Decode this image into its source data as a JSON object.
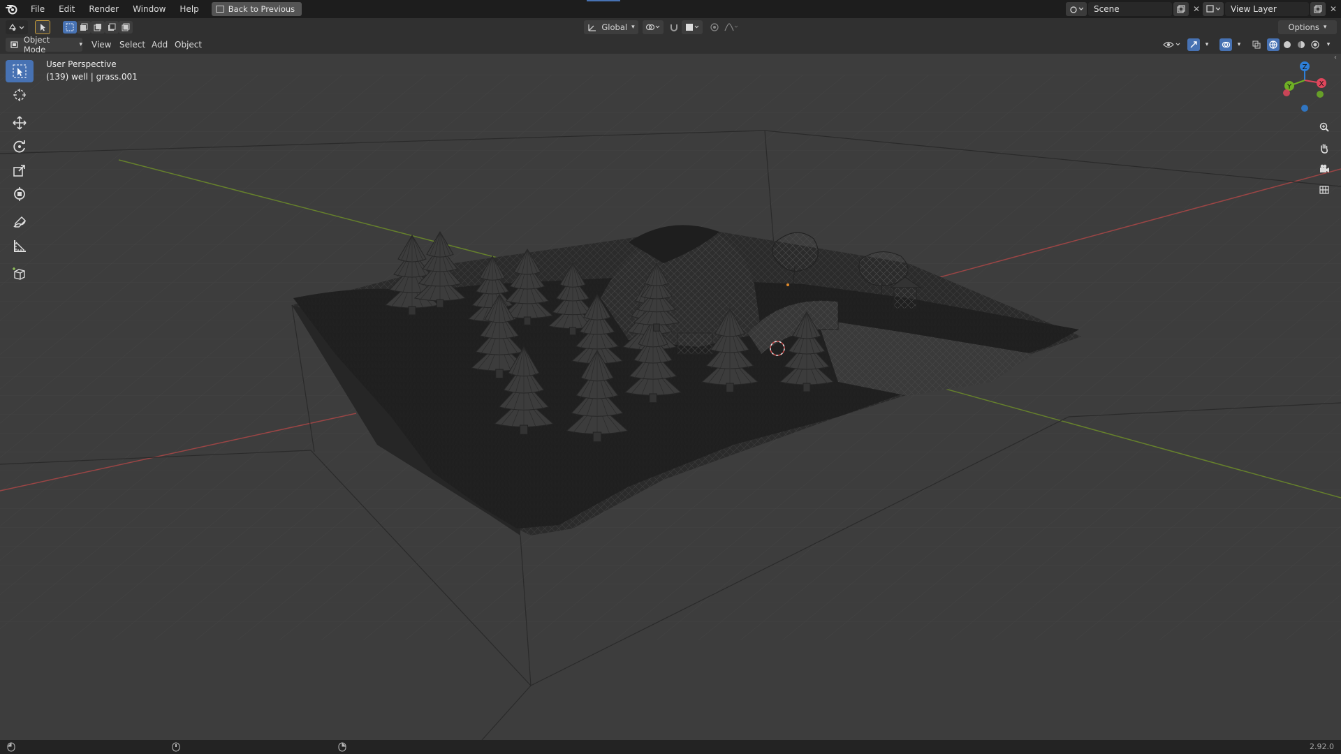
{
  "menu": {
    "items": [
      "File",
      "Edit",
      "Render",
      "Window",
      "Help"
    ],
    "back_button": "Back to Previous"
  },
  "scene": {
    "scene_name": "Scene",
    "view_layer": "View Layer"
  },
  "header": {
    "orientation": "Global",
    "options": "Options"
  },
  "viewport_header": {
    "mode": "Object Mode",
    "menus": [
      "View",
      "Select",
      "Add",
      "Object"
    ]
  },
  "viewport": {
    "view_name": "User Perspective",
    "object_info": "(139) well | grass.001"
  },
  "gizmo": {
    "axes": [
      "X",
      "Y",
      "Z"
    ],
    "colors": {
      "x": "#e0465c",
      "y": "#6fb025",
      "z": "#2e7fd8"
    }
  },
  "toolbar": {
    "tools": [
      "select-box",
      "cursor",
      "move",
      "rotate",
      "scale",
      "transform",
      "annotate",
      "measure",
      "add-cube"
    ]
  },
  "status": {
    "version": "2.92.0"
  },
  "colors": {
    "accent": "#4772b3",
    "x_axis": "#b34a4a",
    "y_axis": "#6c8f2e"
  }
}
